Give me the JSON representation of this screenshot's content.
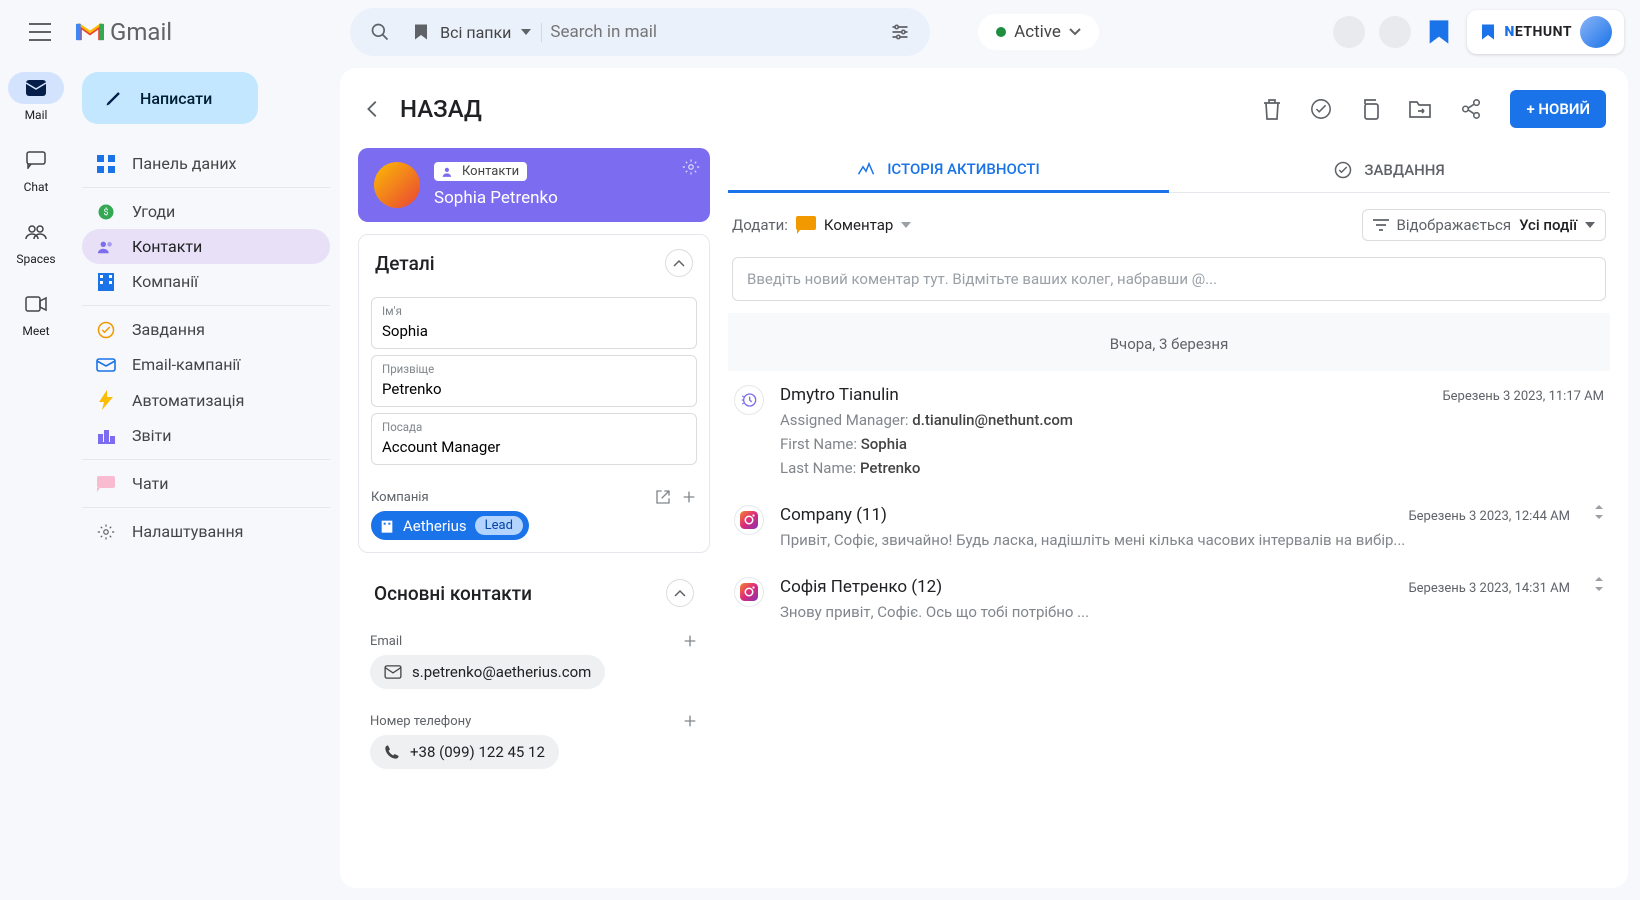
{
  "header": {
    "brand": "Gmail",
    "folder_label": "Всі папки",
    "search_placeholder": "Search in mail",
    "status_label": "Active",
    "nethunt": {
      "prefix": "N",
      "rest": "ETHUNT"
    }
  },
  "rail": [
    {
      "id": "mail",
      "label": "Mail",
      "active": true
    },
    {
      "id": "chat",
      "label": "Chat",
      "active": false
    },
    {
      "id": "spaces",
      "label": "Spaces",
      "active": false
    },
    {
      "id": "meet",
      "label": "Meet",
      "active": false
    }
  ],
  "compose_label": "Написати",
  "nav": [
    {
      "key": "dashboard",
      "label": "Панель даних",
      "icon": "grid",
      "sep": false
    },
    {
      "key": "deals",
      "label": "Угоди",
      "icon": "deal",
      "sep": true
    },
    {
      "key": "contacts",
      "label": "Контакти",
      "icon": "contacts",
      "active": true
    },
    {
      "key": "companies",
      "label": "Компанії",
      "icon": "building",
      "sep": false
    },
    {
      "key": "tasks",
      "label": "Завдання",
      "icon": "task",
      "sep": true
    },
    {
      "key": "campaigns",
      "label": "Email-кампанії",
      "icon": "campaign"
    },
    {
      "key": "automation",
      "label": "Автоматизація",
      "icon": "bolt"
    },
    {
      "key": "reports",
      "label": "Звіти",
      "icon": "chart",
      "sep": false
    },
    {
      "key": "chats",
      "label": "Чати",
      "icon": "chatpink",
      "sep": true
    },
    {
      "key": "settings",
      "label": "Налаштування",
      "icon": "gear",
      "sep": true
    }
  ],
  "back_label": "НАЗАД",
  "new_button": "+ НОВИЙ",
  "contact": {
    "tag": "Контакти",
    "name": "Sophia Petrenko"
  },
  "details": {
    "title": "Деталі",
    "fields": {
      "first_name": {
        "label": "Ім'я",
        "value": "Sophia"
      },
      "last_name": {
        "label": "Призвіще",
        "value": "Petrenko"
      },
      "position": {
        "label": "Посада",
        "value": "Account Manager"
      }
    },
    "company": {
      "label": "Компанія",
      "name": "Aetherius",
      "stage": "Lead"
    }
  },
  "primary": {
    "title": "Основні контакти",
    "email": {
      "label": "Email",
      "value": "s.petrenko@aetherius.com"
    },
    "phone": {
      "label": "Номер телефону",
      "value": "+38 (099) 122 45 12"
    }
  },
  "tabs": {
    "activity": "ІСТОРІЯ АКТИВНОСТІ",
    "tasks": "ЗАВДАННЯ"
  },
  "activity_bar": {
    "add_label": "Додати:",
    "comment_label": "Коментар",
    "filter_label": "Відображається",
    "filter_value": "Усі події"
  },
  "comment_placeholder": "Введіть новий коментар тут. Відмітьте ваших колег, набравши @...",
  "date_divider": "Вчора, 3 березня",
  "activity": [
    {
      "icon": "history",
      "title": "Dmytro Tianulin",
      "time": "Березень 3 2023, 11:17 AM",
      "lines": [
        {
          "label": "Assigned Manager:",
          "value": "d.tianulin@nethunt.com"
        },
        {
          "label": "First Name:",
          "value": "Sophia"
        },
        {
          "label": "Last Name:",
          "value": "Petrenko"
        }
      ]
    },
    {
      "icon": "instagram",
      "title": "Company (11)",
      "time": "Березень 3 2023, 12:44 AM",
      "snippet": "Привіт, Софіє, звичайно! Будь ласка, надішліть мені кілька часових інтервалів на вибір..."
    },
    {
      "icon": "instagram",
      "title": "Софія Петренко (12)",
      "time": "Березень 3 2023, 14:31 AM",
      "snippet": "Знову привіт, Софіє. Ось що тобі потрібно ..."
    }
  ]
}
